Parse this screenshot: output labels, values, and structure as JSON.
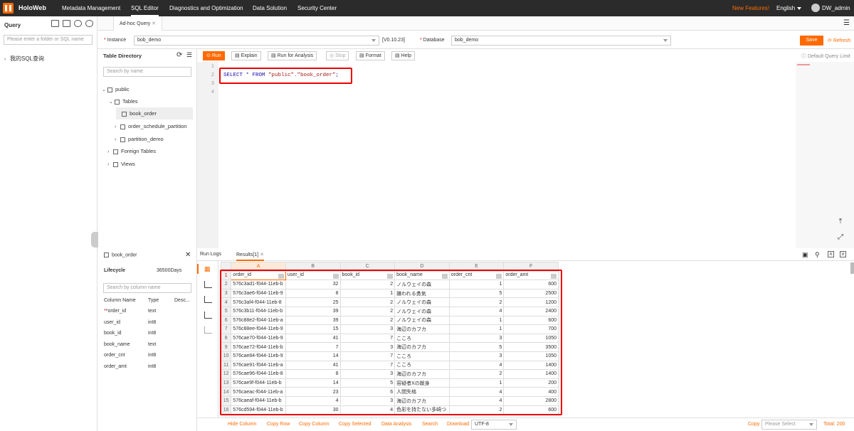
{
  "topbar": {
    "brand": "HoloWeb",
    "nav": [
      "Metadata Management",
      "SQL Editor",
      "Diagnostics and Optimization",
      "Data Solution",
      "Security Center"
    ],
    "new_features": "New Features!",
    "language": "English",
    "user": "DW_admin"
  },
  "query": {
    "title": "Query",
    "search_placeholder": "Please enter a folder or SQL name",
    "my_sql": "我的SQL查询"
  },
  "tab": {
    "label": "Ad-hoc Query"
  },
  "instance": {
    "label": "Instance",
    "value": "bob_demo",
    "version": "[V0.10.23]",
    "db_label": "Database",
    "db_value": "bob_demo",
    "save": "Save",
    "refresh": "Refresh"
  },
  "directory": {
    "title": "Table Directory",
    "search_placeholder": "Search by name",
    "schema": "public",
    "tables": "Tables",
    "items": [
      "book_order",
      "order_schedule_partition",
      "partition_demo"
    ],
    "foreign": "Foreign Tables",
    "views": "Views"
  },
  "toolbar": {
    "run": "Run",
    "explain": "Explain",
    "run_analysis": "Run for Analysis",
    "stop": "Stop",
    "format": "Format",
    "help": "Help",
    "default_limit": "Default Query Limit"
  },
  "editor": {
    "lines": [
      "1",
      "2",
      "3",
      "4"
    ],
    "code_kw": "SELECT * FROM ",
    "code_str": "\"public\".\"book_order\"",
    "code_end": ";"
  },
  "tableinfo": {
    "name": "book_order",
    "lifecycle_label": "Lifecycle",
    "lifecycle_value": "36500Days",
    "search_placeholder": "Search by column name",
    "headers": [
      "Column Name",
      "Type",
      "Desc..."
    ],
    "columns": [
      [
        "*order_id",
        "text"
      ],
      [
        "user_id",
        "int8"
      ],
      [
        "book_id",
        "int8"
      ],
      [
        "book_name",
        "text"
      ],
      [
        "order_cnt",
        "int8"
      ],
      [
        "order_amt",
        "int8"
      ]
    ]
  },
  "results": {
    "tab_logs": "Run Logs",
    "tab_results": "Results[1]",
    "letters": [
      "A",
      "B",
      "C",
      "D",
      "E",
      "F"
    ],
    "headers": [
      "order_id",
      "user_id",
      "book_id",
      "book_name",
      "order_cnt",
      "order_amt"
    ],
    "rows": [
      [
        "576c3ad1-f044-11eb-b",
        "32",
        "2",
        "ノルウェイの森",
        "1",
        "600"
      ],
      [
        "576c3ae6-f044-11eb-9",
        "8",
        "1",
        "嫌われる勇気",
        "5",
        "2500"
      ],
      [
        "576c3af4-f044-11eb-8",
        "25",
        "2",
        "ノルウェイの森",
        "2",
        "1200"
      ],
      [
        "576c3b11-f044-11eb-b",
        "39",
        "2",
        "ノルウェイの森",
        "4",
        "2400"
      ],
      [
        "576c88e2-f044-11eb-a",
        "39",
        "2",
        "ノルウェイの森",
        "1",
        "600"
      ],
      [
        "576c88ee-f044-11eb-9",
        "15",
        "3",
        "海辺のカフカ",
        "1",
        "700"
      ],
      [
        "576cae70-f044-11eb-9",
        "41",
        "7",
        "こころ",
        "3",
        "1050"
      ],
      [
        "576cae72-f044-11eb-b",
        "7",
        "3",
        "海辺のカフカ",
        "5",
        "3500"
      ],
      [
        "576cae84-f044-11eb-9",
        "14",
        "7",
        "こころ",
        "3",
        "1050"
      ],
      [
        "576cae91-f044-11eb-a",
        "41",
        "7",
        "こころ",
        "4",
        "1400"
      ],
      [
        "576cae96-f044-11eb-8",
        "8",
        "3",
        "海辺のカフカ",
        "2",
        "1400"
      ],
      [
        "576cae9f-f044-11eb-b",
        "14",
        "5",
        "容疑者Xの献身",
        "1",
        "200"
      ],
      [
        "576caeac-f044-11eb-a",
        "23",
        "6",
        "人間失格",
        "4",
        "400"
      ],
      [
        "576caeaf-f044-11eb-b",
        "4",
        "3",
        "海辺のカフカ",
        "4",
        "2800"
      ],
      [
        "576cd594-f044-11eb-b",
        "30",
        "4",
        "色彩を持たない多崎つ",
        "2",
        "600"
      ]
    ]
  },
  "status": {
    "hide_column": "Hide Column",
    "copy_row": "Copy Row",
    "copy_column": "Copy Column",
    "copy_selected": "Copy Selected",
    "data_analysis": "Data Analysis",
    "search": "Search",
    "download": "Download",
    "encoding": "UTF-8",
    "copy": "Copy",
    "please_select": "Please Select",
    "total": "Total: 200"
  },
  "colors": {
    "accent": "#ff6a00",
    "highlight": "#e00000"
  }
}
